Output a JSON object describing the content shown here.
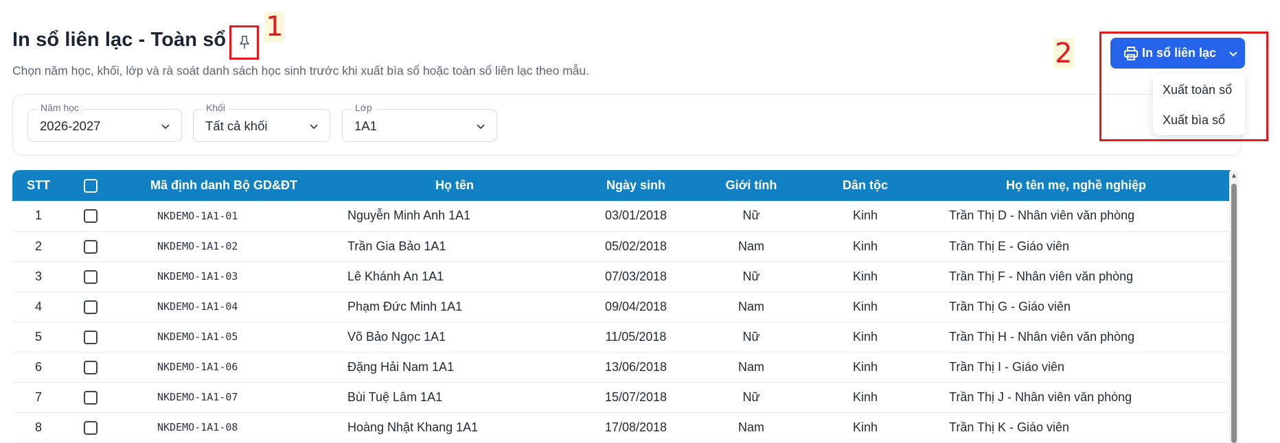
{
  "page": {
    "title": "In sổ liên lạc - Toàn sổ",
    "subtitle": "Chọn năm học, khối, lớp và rà soát danh sách học sinh trước khi xuất bìa sổ hoặc toàn sổ liên lạc theo mẫu."
  },
  "annotations": {
    "one": "1",
    "two": "2"
  },
  "filters": {
    "year": {
      "label": "Năm học",
      "value": "2026-2027"
    },
    "grade": {
      "label": "Khối",
      "value": "Tất cả khối"
    },
    "class": {
      "label": "Lớp",
      "value": "1A1"
    }
  },
  "print_button": {
    "label": "In sổ liên lạc",
    "menu": [
      "Xuất toàn sổ",
      "Xuất bìa sổ"
    ]
  },
  "table": {
    "columns": [
      "STT",
      "Mã định danh Bộ GD&ĐT",
      "Họ tên",
      "Ngày sinh",
      "Giới tính",
      "Dân tộc",
      "Họ tên mẹ, nghề nghiệp"
    ],
    "rows": [
      [
        "1",
        "NKDEMO-1A1-01",
        "Nguyễn Minh Anh 1A1",
        "03/01/2018",
        "Nữ",
        "Kinh",
        "Trần Thị D - Nhân viên văn phòng"
      ],
      [
        "2",
        "NKDEMO-1A1-02",
        "Trần Gia Bảo 1A1",
        "05/02/2018",
        "Nam",
        "Kinh",
        "Trần Thị E - Giáo viên"
      ],
      [
        "3",
        "NKDEMO-1A1-03",
        "Lê Khánh An 1A1",
        "07/03/2018",
        "Nữ",
        "Kinh",
        "Trần Thị F - Nhân viên văn phòng"
      ],
      [
        "4",
        "NKDEMO-1A1-04",
        "Phạm Đức Minh 1A1",
        "09/04/2018",
        "Nam",
        "Kinh",
        "Trần Thị G - Giáo viên"
      ],
      [
        "5",
        "NKDEMO-1A1-05",
        "Võ Bảo Ngọc 1A1",
        "11/05/2018",
        "Nữ",
        "Kinh",
        "Trần Thị H - Nhân viên văn phòng"
      ],
      [
        "6",
        "NKDEMO-1A1-06",
        "Đặng Hải Nam 1A1",
        "13/06/2018",
        "Nam",
        "Kinh",
        "Trần Thị I - Giáo viên"
      ],
      [
        "7",
        "NKDEMO-1A1-07",
        "Bùi Tuệ Lâm 1A1",
        "15/07/2018",
        "Nữ",
        "Kinh",
        "Trần Thị J - Nhân viên văn phòng"
      ],
      [
        "8",
        "NKDEMO-1A1-08",
        "Hoàng Nhật Khang 1A1",
        "17/08/2018",
        "Nam",
        "Kinh",
        "Trần Thị K - Giáo viên"
      ]
    ]
  },
  "icons": {
    "pin": "pin-icon",
    "printer": "printer-icon",
    "chevron": "chevron-down-icon",
    "checkbox": "checkbox-icon"
  },
  "colors": {
    "header_bg": "#1181c3",
    "primary_button": "#2563eb",
    "annotation": "#e2191f"
  }
}
